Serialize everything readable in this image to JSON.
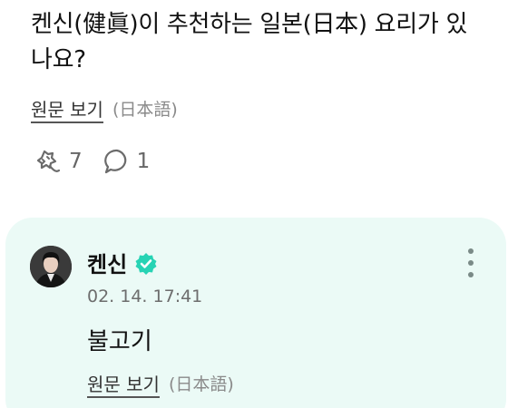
{
  "question": {
    "text": "켄신(健眞)이 추천하는 일본(日本) 요리가 있나요?",
    "view_original_label": "원문 보기",
    "original_language": "(日本語)",
    "like_count": "7",
    "comment_count": "1"
  },
  "reply": {
    "author_name": "켄신",
    "timestamp": "02. 14. 17:41",
    "text": "불고기",
    "view_original_label": "원문 보기",
    "original_language": "(日本語)"
  },
  "colors": {
    "reply_card_bg": "#ebfaf6",
    "verified_badge": "#27d3b4",
    "icon_gray": "#6b6b6b"
  },
  "icons": [
    "like-icon",
    "comment-icon",
    "verified-badge-icon",
    "more-options-icon"
  ]
}
